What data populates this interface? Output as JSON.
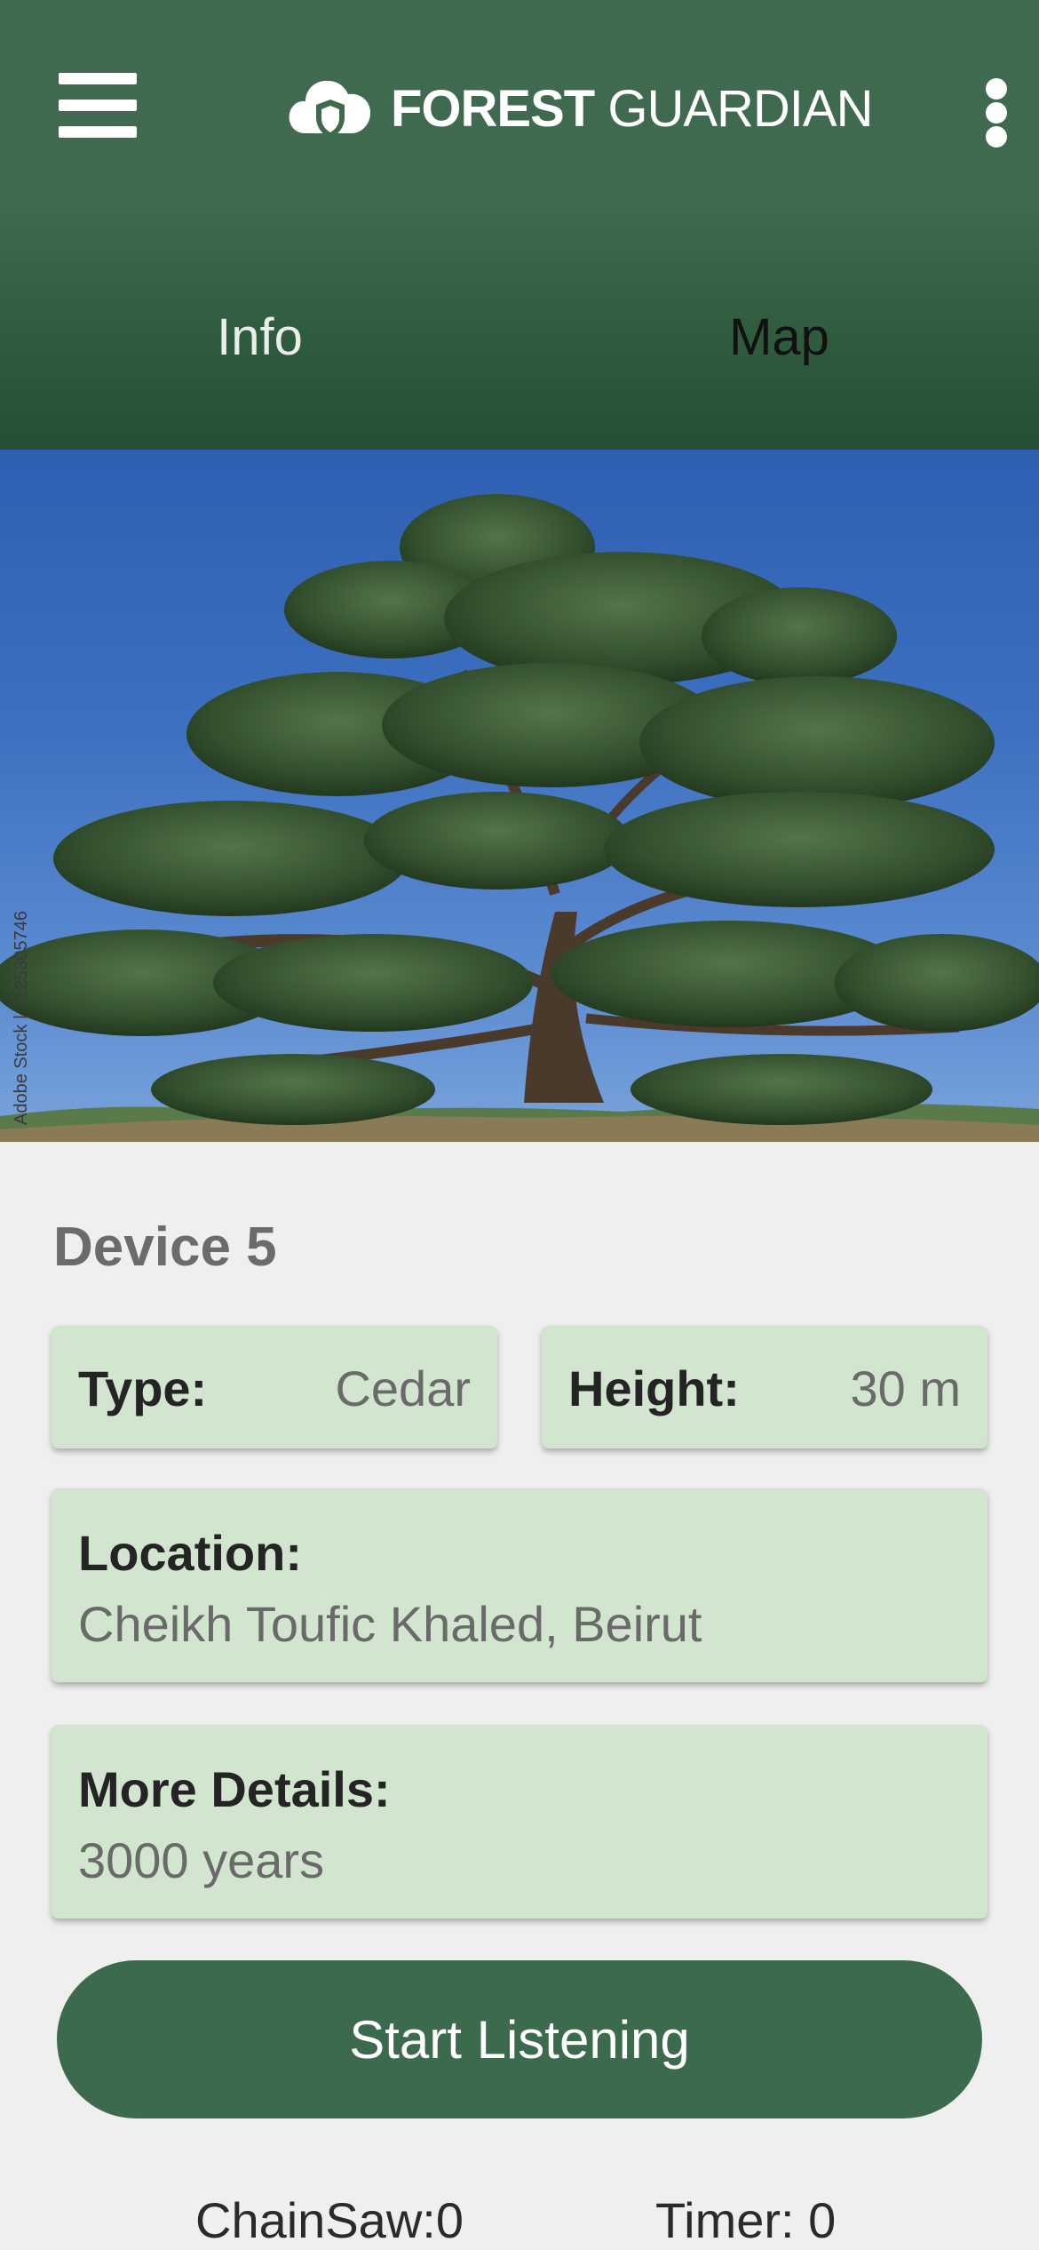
{
  "app": {
    "brand_bold": "FOREST",
    "brand_light": " GUARDIAN",
    "colors": {
      "header": "#3f6a4e",
      "card": "#d2e6cf",
      "button": "#3b6a4d",
      "background": "#efefef"
    }
  },
  "header": {
    "menu_icon": "hamburger-menu-icon",
    "logo_icon": "cloud-shield-icon",
    "overflow_icon": "more-vertical-icon"
  },
  "tabs": [
    {
      "label": "Info"
    },
    {
      "label": "Map"
    }
  ],
  "hero": {
    "watermark": "Adobe Stock | #125305746"
  },
  "device": {
    "title": "Device 5",
    "type_label": "Type:",
    "type_value": "Cedar",
    "height_label": "Height:",
    "height_value": "30 m",
    "location_label": "Location:",
    "location_value": "Cheikh Toufic Khaled, Beirut",
    "details_label": "More Details:",
    "details_value": "3000 years"
  },
  "actions": {
    "listen_label": "Start Listening"
  },
  "counters": {
    "chainsaw": "ChainSaw:0",
    "timer": "Timer: 0"
  }
}
